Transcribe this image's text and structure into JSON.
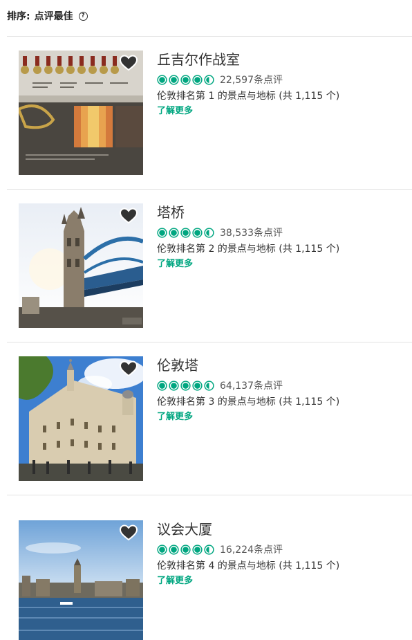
{
  "sort": {
    "label": "排序:",
    "value": "点评最佳",
    "help_glyph": "?"
  },
  "accent_color": "#00a680",
  "attractions": [
    {
      "title": "丘吉尔作战室",
      "rating": 4.5,
      "reviews": "22,597条点评",
      "rank": "伦敦排名第 1 的景点与地标 (共 1,115 个)",
      "more": "了解更多",
      "image": "medals-display"
    },
    {
      "title": "塔桥",
      "rating": 4.5,
      "reviews": "38,533条点评",
      "rank": "伦敦排名第 2 的景点与地标 (共 1,115 个)",
      "more": "了解更多",
      "image": "tower-bridge"
    },
    {
      "title": "伦敦塔",
      "rating": 4.5,
      "reviews": "64,137条点评",
      "rank": "伦敦排名第 3 的景点与地标 (共 1,115 个)",
      "more": "了解更多",
      "image": "tower-of-london"
    },
    {
      "title": "议会大厦",
      "rating": 4.5,
      "reviews": "16,224条点评",
      "rank": "伦敦排名第 4 的景点与地标 (共 1,115 个)",
      "more": "了解更多",
      "image": "houses-of-parliament"
    }
  ]
}
